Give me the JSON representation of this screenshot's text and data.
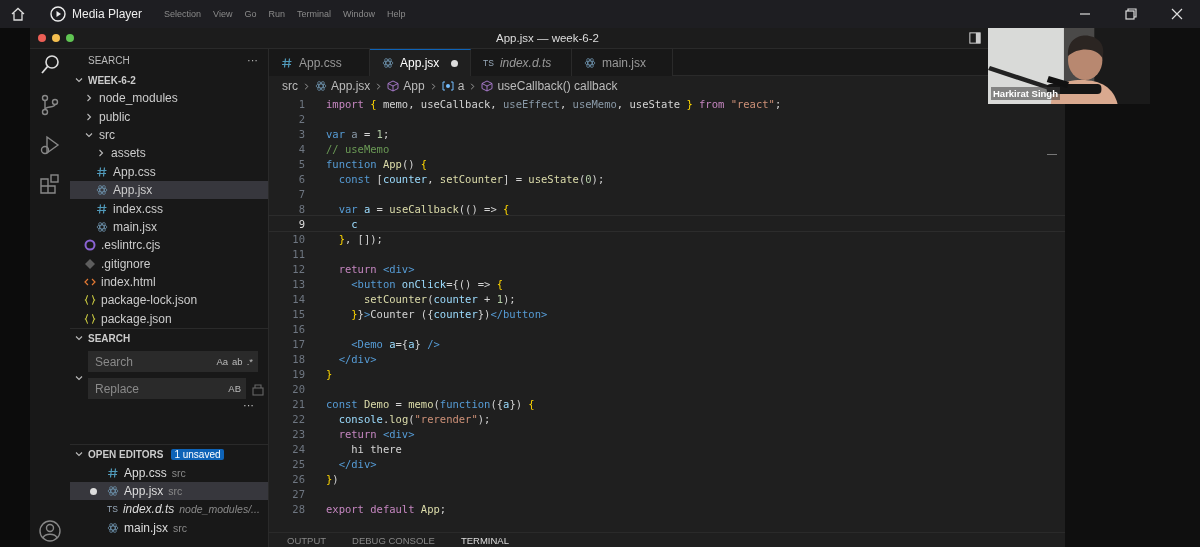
{
  "player": {
    "title": "Media Player",
    "menu": [
      "Selection",
      "View",
      "Go",
      "Run",
      "Terminal",
      "Window",
      "Help"
    ]
  },
  "window": {
    "title": "App.jsx — week-6-2"
  },
  "sidebar": {
    "header": "SEARCH",
    "more": "···",
    "folder": "WEEK-6-2",
    "items": [
      {
        "name": "node_modules",
        "kind": "folder",
        "expanded": false,
        "selected": false
      },
      {
        "name": "public",
        "kind": "folder",
        "expanded": false,
        "selected": false
      },
      {
        "name": "src",
        "kind": "folder",
        "expanded": true,
        "selected": false,
        "children": [
          {
            "name": "assets",
            "kind": "folder",
            "expanded": false,
            "selected": false
          },
          {
            "name": "App.css",
            "kind": "css",
            "selected": false
          },
          {
            "name": "App.jsx",
            "kind": "react",
            "selected": true
          },
          {
            "name": "index.css",
            "kind": "css",
            "selected": false
          },
          {
            "name": "main.jsx",
            "kind": "react",
            "selected": false
          }
        ]
      },
      {
        "name": ".eslintrc.cjs",
        "kind": "eslint",
        "selected": false
      },
      {
        "name": ".gitignore",
        "kind": "git",
        "selected": false
      },
      {
        "name": "index.html",
        "kind": "html",
        "selected": false
      },
      {
        "name": "package-lock.json",
        "kind": "json",
        "selected": false
      },
      {
        "name": "package.json",
        "kind": "json",
        "selected": false
      }
    ],
    "search": {
      "title": "SEARCH",
      "placeholder": "Search",
      "toggles": [
        "Aa",
        "ab",
        ".*"
      ],
      "replace_placeholder": "Replace",
      "replace_toggle": "AB",
      "more": "···"
    },
    "open_editors": {
      "title": "OPEN EDITORS",
      "badge": "1 unsaved",
      "items": [
        {
          "name": "App.css",
          "path": "src",
          "kind": "css",
          "selected": false,
          "unsaved": false,
          "preview": false
        },
        {
          "name": "App.jsx",
          "path": "src",
          "kind": "react",
          "selected": true,
          "unsaved": true,
          "preview": false
        },
        {
          "name": "index.d.ts",
          "path": "node_modules/...",
          "kind": "ts",
          "icon": "TS",
          "selected": false,
          "unsaved": false,
          "preview": true
        },
        {
          "name": "main.jsx",
          "path": "src",
          "kind": "react",
          "selected": false,
          "unsaved": false,
          "preview": false
        }
      ]
    }
  },
  "tabs": [
    {
      "label": "App.css",
      "kind": "css",
      "selected": false,
      "unsaved": false,
      "preview": false
    },
    {
      "label": "App.jsx",
      "kind": "react",
      "selected": true,
      "unsaved": true,
      "preview": false
    },
    {
      "label": "index.d.ts",
      "kind": "ts",
      "icon": "TS",
      "selected": false,
      "unsaved": false,
      "preview": true
    },
    {
      "label": "main.jsx",
      "kind": "react",
      "selected": false,
      "unsaved": false,
      "preview": false
    }
  ],
  "breadcrumbs": [
    {
      "text": "src",
      "kind": "folder"
    },
    {
      "text": "App.jsx",
      "kind": "react"
    },
    {
      "text": "App",
      "kind": "symbol"
    },
    {
      "text": "a",
      "kind": "variable"
    },
    {
      "text": "useCallback() callback",
      "kind": "symbol"
    }
  ],
  "code": [
    {
      "number": "1",
      "current": false,
      "tokens": [
        {
          "kind": "kw",
          "text": "import"
        },
        {
          "kind": "br",
          "text": " { "
        },
        {
          "kind": "p",
          "text": "memo, useCallback, "
        },
        {
          "kind": "dim",
          "text": "useEffect"
        },
        {
          "kind": "p",
          "text": ", "
        },
        {
          "kind": "dim",
          "text": "useMemo"
        },
        {
          "kind": "p",
          "text": ", useState "
        },
        {
          "kind": "br",
          "text": "}"
        },
        {
          "kind": "kw",
          "text": " from "
        },
        {
          "kind": "str",
          "text": "\"react\""
        },
        {
          "kind": "p",
          "text": ";"
        }
      ]
    },
    {
      "number": "2",
      "current": false
    },
    {
      "number": "3",
      "current": false,
      "tokens": [
        {
          "kind": "st",
          "text": "var "
        },
        {
          "kind": "dim",
          "text": "a"
        },
        {
          "kind": "p",
          "text": " = "
        },
        {
          "kind": "num",
          "text": "1"
        },
        {
          "kind": "p",
          "text": ";"
        }
      ]
    },
    {
      "number": "4",
      "current": false,
      "tokens": [
        {
          "kind": "com",
          "text": "// useMemo"
        }
      ]
    },
    {
      "number": "5",
      "current": false,
      "tokens": [
        {
          "kind": "st",
          "text": "function "
        },
        {
          "kind": "fn",
          "text": "App"
        },
        {
          "kind": "p",
          "text": "() "
        },
        {
          "kind": "br",
          "text": "{"
        }
      ]
    },
    {
      "number": "6",
      "current": false,
      "tokens": [
        {
          "kind": "st",
          "text": "  const "
        },
        {
          "kind": "p",
          "text": "["
        },
        {
          "kind": "var",
          "text": "counter"
        },
        {
          "kind": "p",
          "text": ", "
        },
        {
          "kind": "fn",
          "text": "setCounter"
        },
        {
          "kind": "p",
          "text": "] = "
        },
        {
          "kind": "fn",
          "text": "useState"
        },
        {
          "kind": "p",
          "text": "("
        },
        {
          "kind": "num",
          "text": "0"
        },
        {
          "kind": "p",
          "text": ");"
        }
      ]
    },
    {
      "number": "7",
      "current": false
    },
    {
      "number": "8",
      "current": false,
      "tokens": [
        {
          "kind": "st",
          "text": "  var "
        },
        {
          "kind": "var",
          "text": "a"
        },
        {
          "kind": "p",
          "text": " = "
        },
        {
          "kind": "fn",
          "text": "useCallback"
        },
        {
          "kind": "p",
          "text": "(() => "
        },
        {
          "kind": "br",
          "text": "{"
        }
      ]
    },
    {
      "number": "9",
      "current": true,
      "tokens": [
        {
          "kind": "var",
          "text": "    c"
        }
      ]
    },
    {
      "number": "10",
      "current": false,
      "tokens": [
        {
          "kind": "br",
          "text": "  }"
        },
        {
          "kind": "p",
          "text": ", []);"
        }
      ]
    },
    {
      "number": "11",
      "current": false
    },
    {
      "number": "12",
      "current": false,
      "tokens": [
        {
          "kind": "kw",
          "text": "  return "
        },
        {
          "kind": "tag",
          "text": "<div>"
        }
      ]
    },
    {
      "number": "13",
      "current": false,
      "tokens": [
        {
          "kind": "tag",
          "text": "    <button "
        },
        {
          "kind": "var",
          "text": "onClick"
        },
        {
          "kind": "p",
          "text": "={() => "
        },
        {
          "kind": "br",
          "text": "{"
        }
      ]
    },
    {
      "number": "14",
      "current": false,
      "tokens": [
        {
          "kind": "fn",
          "text": "      setCounter"
        },
        {
          "kind": "p",
          "text": "("
        },
        {
          "kind": "var",
          "text": "counter"
        },
        {
          "kind": "p",
          "text": " + "
        },
        {
          "kind": "num",
          "text": "1"
        },
        {
          "kind": "p",
          "text": ");"
        }
      ]
    },
    {
      "number": "15",
      "current": false,
      "tokens": [
        {
          "kind": "br",
          "text": "    }"
        },
        {
          "kind": "p",
          "text": "}"
        },
        {
          "kind": "tag",
          "text": ">"
        },
        {
          "kind": "p",
          "text": "Counter ({"
        },
        {
          "kind": "var",
          "text": "counter"
        },
        {
          "kind": "p",
          "text": "})"
        },
        {
          "kind": "tag",
          "text": "</button>"
        }
      ]
    },
    {
      "number": "16",
      "current": false
    },
    {
      "number": "17",
      "current": false,
      "tokens": [
        {
          "kind": "tag",
          "text": "    <Demo "
        },
        {
          "kind": "var",
          "text": "a"
        },
        {
          "kind": "p",
          "text": "={"
        },
        {
          "kind": "var",
          "text": "a"
        },
        {
          "kind": "p",
          "text": "} "
        },
        {
          "kind": "tag",
          "text": "/>"
        }
      ]
    },
    {
      "number": "18",
      "current": false,
      "tokens": [
        {
          "kind": "tag",
          "text": "  </div>"
        }
      ]
    },
    {
      "number": "19",
      "current": false,
      "tokens": [
        {
          "kind": "br",
          "text": "}"
        }
      ]
    },
    {
      "number": "20",
      "current": false
    },
    {
      "number": "21",
      "current": false,
      "tokens": [
        {
          "kind": "st",
          "text": "const "
        },
        {
          "kind": "fn",
          "text": "Demo"
        },
        {
          "kind": "p",
          "text": " = "
        },
        {
          "kind": "fn",
          "text": "memo"
        },
        {
          "kind": "p",
          "text": "("
        },
        {
          "kind": "st",
          "text": "function"
        },
        {
          "kind": "p",
          "text": "({"
        },
        {
          "kind": "var",
          "text": "a"
        },
        {
          "kind": "p",
          "text": "}) "
        },
        {
          "kind": "br",
          "text": "{"
        }
      ]
    },
    {
      "number": "22",
      "current": false,
      "tokens": [
        {
          "kind": "var",
          "text": "  console"
        },
        {
          "kind": "p",
          "text": "."
        },
        {
          "kind": "fn",
          "text": "log"
        },
        {
          "kind": "p",
          "text": "("
        },
        {
          "kind": "str",
          "text": "\"rerender\""
        },
        {
          "kind": "p",
          "text": ");"
        }
      ]
    },
    {
      "number": "23",
      "current": false,
      "tokens": [
        {
          "kind": "kw",
          "text": "  return "
        },
        {
          "kind": "tag",
          "text": "<div>"
        }
      ]
    },
    {
      "number": "24",
      "current": false,
      "tokens": [
        {
          "kind": "p",
          "text": "    hi there"
        }
      ]
    },
    {
      "number": "25",
      "current": false,
      "tokens": [
        {
          "kind": "tag",
          "text": "  </div>"
        }
      ]
    },
    {
      "number": "26",
      "current": false,
      "tokens": [
        {
          "kind": "br",
          "text": "}"
        },
        {
          "kind": "p",
          "text": ")"
        }
      ]
    },
    {
      "number": "27",
      "current": false
    },
    {
      "number": "28",
      "current": false,
      "tokens": [
        {
          "kind": "kw",
          "text": "export default "
        },
        {
          "kind": "fn",
          "text": "App"
        },
        {
          "kind": "p",
          "text": ";"
        }
      ]
    }
  ],
  "panel": {
    "tabs": [
      {
        "label": "OUTPUT",
        "selected": false
      },
      {
        "label": "DEBUG CONSOLE",
        "selected": false
      },
      {
        "label": "TERMINAL",
        "selected": true
      }
    ]
  },
  "webcam": {
    "name": "Harkirat Singh"
  }
}
